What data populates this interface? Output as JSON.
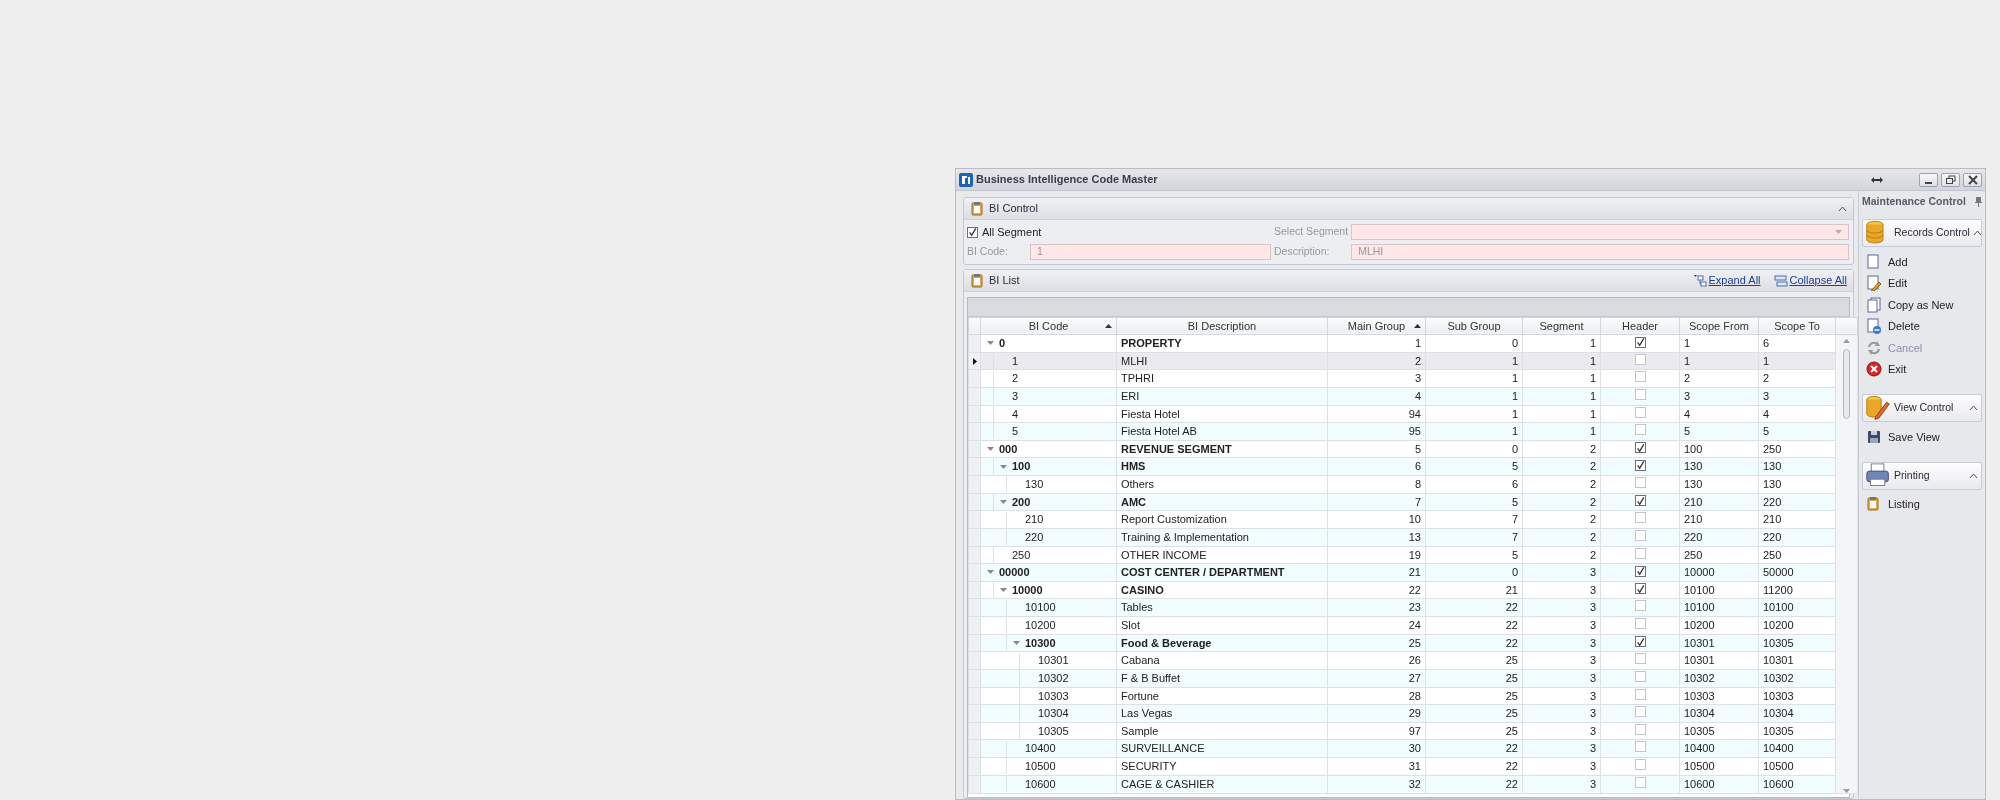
{
  "window": {
    "title": "Business Intelligence Code Master"
  },
  "bi_control": {
    "title": "BI Control",
    "all_segment": {
      "label": "All Segment",
      "checked": true
    },
    "select_segment": {
      "label": "Select Segment"
    },
    "bi_code": {
      "label": "BI Code:",
      "value": "1"
    },
    "description": {
      "label": "Description:",
      "value": "MLHI"
    }
  },
  "bi_list": {
    "title": "BI List",
    "actions": [
      "Expand All",
      "Collapse All"
    ],
    "columns": [
      {
        "label": "BI Code",
        "sorted": true
      },
      {
        "label": "BI Description",
        "sorted": false
      },
      {
        "label": "Main Group",
        "sorted": true
      },
      {
        "label": "Sub Group",
        "sorted": false
      },
      {
        "label": "Segment",
        "sorted": false
      },
      {
        "label": "Header",
        "sorted": false
      },
      {
        "label": "Scope From",
        "sorted": false
      },
      {
        "label": "Scope To",
        "sorted": false
      }
    ],
    "rows": [
      {
        "code": "0",
        "description": "PROPERTY",
        "main_group": "1",
        "sub_group": "0",
        "segment": "1",
        "header": true,
        "scope_from": "1",
        "scope_to": "6",
        "selected": false,
        "expanded": true,
        "children": [
          {
            "code": "1",
            "description": "MLHI",
            "main_group": "2",
            "sub_group": "1",
            "segment": "1",
            "header": false,
            "scope_from": "1",
            "scope_to": "1",
            "selected": true
          },
          {
            "code": "2",
            "description": "TPHRI",
            "main_group": "3",
            "sub_group": "1",
            "segment": "1",
            "header": false,
            "scope_from": "2",
            "scope_to": "2",
            "selected": false
          },
          {
            "code": "3",
            "description": "ERI",
            "main_group": "4",
            "sub_group": "1",
            "segment": "1",
            "header": false,
            "scope_from": "3",
            "scope_to": "3",
            "selected": false
          },
          {
            "code": "4",
            "description": "Fiesta Hotel",
            "main_group": "94",
            "sub_group": "1",
            "segment": "1",
            "header": false,
            "scope_from": "4",
            "scope_to": "4",
            "selected": false
          },
          {
            "code": "5",
            "description": "Fiesta Hotel AB",
            "main_group": "95",
            "sub_group": "1",
            "segment": "1",
            "header": false,
            "scope_from": "5",
            "scope_to": "5",
            "selected": false
          }
        ]
      },
      {
        "code": "000",
        "description": "REVENUE SEGMENT",
        "main_group": "5",
        "sub_group": "0",
        "segment": "2",
        "header": true,
        "scope_from": "100",
        "scope_to": "250",
        "selected": false,
        "expanded": true,
        "children": [
          {
            "code": "100",
            "description": "HMS",
            "main_group": "6",
            "sub_group": "5",
            "segment": "2",
            "header": true,
            "scope_from": "130",
            "scope_to": "130",
            "selected": false,
            "expanded": true,
            "children": [
              {
                "code": "130",
                "description": "Others",
                "main_group": "8",
                "sub_group": "6",
                "segment": "2",
                "header": false,
                "scope_from": "130",
                "scope_to": "130",
                "selected": false
              }
            ]
          },
          {
            "code": "200",
            "description": "AMC",
            "main_group": "7",
            "sub_group": "5",
            "segment": "2",
            "header": true,
            "scope_from": "210",
            "scope_to": "220",
            "selected": false,
            "expanded": true,
            "children": [
              {
                "code": "210",
                "description": "Report Customization",
                "main_group": "10",
                "sub_group": "7",
                "segment": "2",
                "header": false,
                "scope_from": "210",
                "scope_to": "210",
                "selected": false
              },
              {
                "code": "220",
                "description": "Training & Implementation",
                "main_group": "13",
                "sub_group": "7",
                "segment": "2",
                "header": false,
                "scope_from": "220",
                "scope_to": "220",
                "selected": false
              }
            ]
          },
          {
            "code": "250",
            "description": "OTHER INCOME",
            "main_group": "19",
            "sub_group": "5",
            "segment": "2",
            "header": false,
            "scope_from": "250",
            "scope_to": "250",
            "selected": false
          }
        ]
      },
      {
        "code": "00000",
        "description": "COST CENTER / DEPARTMENT",
        "main_group": "21",
        "sub_group": "0",
        "segment": "3",
        "header": true,
        "scope_from": "10000",
        "scope_to": "50000",
        "selected": false,
        "expanded": true,
        "children": [
          {
            "code": "10000",
            "description": "CASINO",
            "main_group": "22",
            "sub_group": "21",
            "segment": "3",
            "header": true,
            "scope_from": "10100",
            "scope_to": "11200",
            "selected": false,
            "expanded": true,
            "children": [
              {
                "code": "10100",
                "description": "Tables",
                "main_group": "23",
                "sub_group": "22",
                "segment": "3",
                "header": false,
                "scope_from": "10100",
                "scope_to": "10100",
                "selected": false
              },
              {
                "code": "10200",
                "description": "Slot",
                "main_group": "24",
                "sub_group": "22",
                "segment": "3",
                "header": false,
                "scope_from": "10200",
                "scope_to": "10200",
                "selected": false
              },
              {
                "code": "10300",
                "description": "Food & Beverage",
                "main_group": "25",
                "sub_group": "22",
                "segment": "3",
                "header": true,
                "scope_from": "10301",
                "scope_to": "10305",
                "selected": false,
                "expanded": true,
                "children": [
                  {
                    "code": "10301",
                    "description": "Cabana",
                    "main_group": "26",
                    "sub_group": "25",
                    "segment": "3",
                    "header": false,
                    "scope_from": "10301",
                    "scope_to": "10301",
                    "selected": false
                  },
                  {
                    "code": "10302",
                    "description": "F & B Buffet",
                    "main_group": "27",
                    "sub_group": "25",
                    "segment": "3",
                    "header": false,
                    "scope_from": "10302",
                    "scope_to": "10302",
                    "selected": false
                  },
                  {
                    "code": "10303",
                    "description": "Fortune",
                    "main_group": "28",
                    "sub_group": "25",
                    "segment": "3",
                    "header": false,
                    "scope_from": "10303",
                    "scope_to": "10303",
                    "selected": false
                  },
                  {
                    "code": "10304",
                    "description": "Las Vegas",
                    "main_group": "29",
                    "sub_group": "25",
                    "segment": "3",
                    "header": false,
                    "scope_from": "10304",
                    "scope_to": "10304",
                    "selected": false
                  },
                  {
                    "code": "10305",
                    "description": "Sample",
                    "main_group": "97",
                    "sub_group": "25",
                    "segment": "3",
                    "header": false,
                    "scope_from": "10305",
                    "scope_to": "10305",
                    "selected": false
                  }
                ]
              },
              {
                "code": "10400",
                "description": "SURVEILLANCE",
                "main_group": "30",
                "sub_group": "22",
                "segment": "3",
                "header": false,
                "scope_from": "10400",
                "scope_to": "10400",
                "selected": false
              },
              {
                "code": "10500",
                "description": "SECURITY",
                "main_group": "31",
                "sub_group": "22",
                "segment": "3",
                "header": false,
                "scope_from": "10500",
                "scope_to": "10500",
                "selected": false
              },
              {
                "code": "10600",
                "description": "CAGE & CASHIER",
                "main_group": "32",
                "sub_group": "22",
                "segment": "3",
                "header": false,
                "scope_from": "10600",
                "scope_to": "10600",
                "selected": false
              }
            ]
          }
        ]
      }
    ]
  },
  "maintenance_control": {
    "title": "Maintenance Control",
    "groups": [
      {
        "title": "Records Control",
        "items": [
          {
            "label": "Add",
            "disabled": false
          },
          {
            "label": "Edit",
            "disabled": false
          },
          {
            "label": "Copy as New",
            "disabled": false
          },
          {
            "label": "Delete",
            "disabled": false
          },
          {
            "label": "Cancel",
            "disabled": true
          },
          {
            "label": "Exit",
            "disabled": false
          }
        ]
      },
      {
        "title": "View Control",
        "items": [
          {
            "label": "Save View",
            "disabled": false
          }
        ]
      },
      {
        "title": "Printing",
        "items": [
          {
            "label": "Listing",
            "disabled": false
          }
        ]
      }
    ]
  }
}
